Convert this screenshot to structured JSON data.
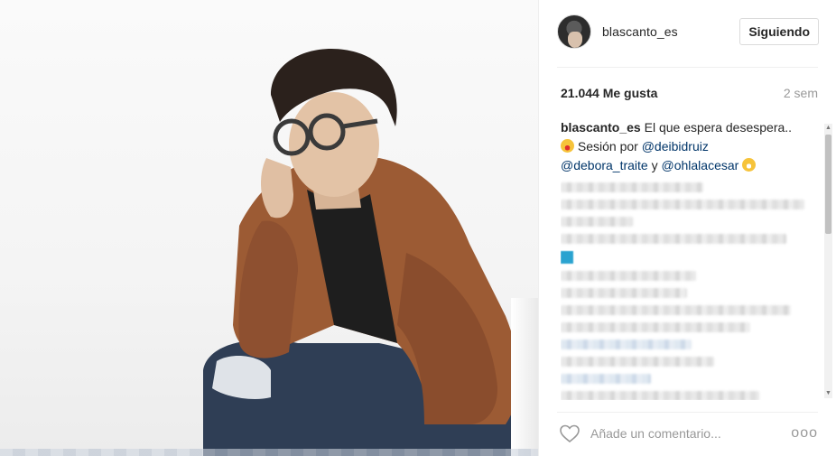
{
  "post": {
    "username": "blascanto_es",
    "follow_label": "Siguiendo",
    "likes": "21.044 Me gusta",
    "time": "2 sem",
    "caption": {
      "user": "blascanto_es",
      "text1": "El que espera desespera..",
      "text2": "Sesión por",
      "mention1": "@deibidruiz",
      "mention2": "@debora_traite",
      "joiner": "y",
      "mention3": "@ohlalacesar"
    },
    "comment_placeholder": "Añade un comentario...",
    "more_label": "ooo"
  },
  "colors": {
    "link": "#003569",
    "text": "#262626",
    "muted": "#999999"
  },
  "icons": {
    "like": "heart-icon",
    "more": "more-options-icon"
  }
}
